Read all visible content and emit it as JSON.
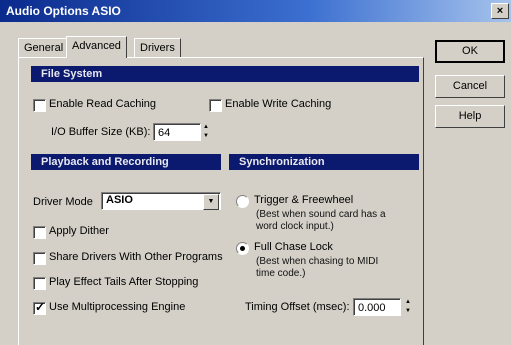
{
  "window": {
    "title": "Audio Options   ASIO",
    "close_glyph": "×"
  },
  "tabs": [
    {
      "label": "General"
    },
    {
      "label": "Advanced"
    },
    {
      "label": "Drivers"
    }
  ],
  "buttons": {
    "ok": "OK",
    "cancel": "Cancel",
    "help": "Help"
  },
  "file_system": {
    "heading": "File System",
    "enable_read_caching": {
      "label": "Enable Read Caching",
      "checked": false
    },
    "enable_write_caching": {
      "label": "Enable Write Caching",
      "checked": false
    },
    "io_buffer_label": "I/O Buffer Size (KB):",
    "io_buffer_value": "64"
  },
  "playback": {
    "heading": "Playback and Recording",
    "driver_mode_label": "Driver Mode",
    "driver_mode_value": "ASIO",
    "apply_dither": {
      "label": "Apply Dither",
      "checked": false
    },
    "share_drivers": {
      "label": "Share Drivers With Other Programs",
      "checked": false
    },
    "play_effect_tails": {
      "label": "Play Effect Tails After Stopping",
      "checked": false
    },
    "use_multiprocessing": {
      "label": "Use Multiprocessing Engine",
      "checked": true
    }
  },
  "synchronization": {
    "heading": "Synchronization",
    "trigger_freewheel": {
      "label": "Trigger & Freewheel",
      "note_line1": "(Best when sound card has a",
      "note_line2": "word clock input.)",
      "selected": false
    },
    "full_chase_lock": {
      "label": "Full Chase Lock",
      "note_line1": "(Best when chasing to MIDI",
      "note_line2": "time code.)",
      "selected": true
    },
    "timing_offset_label": "Timing Offset (msec):",
    "timing_offset_value": "0.000"
  }
}
